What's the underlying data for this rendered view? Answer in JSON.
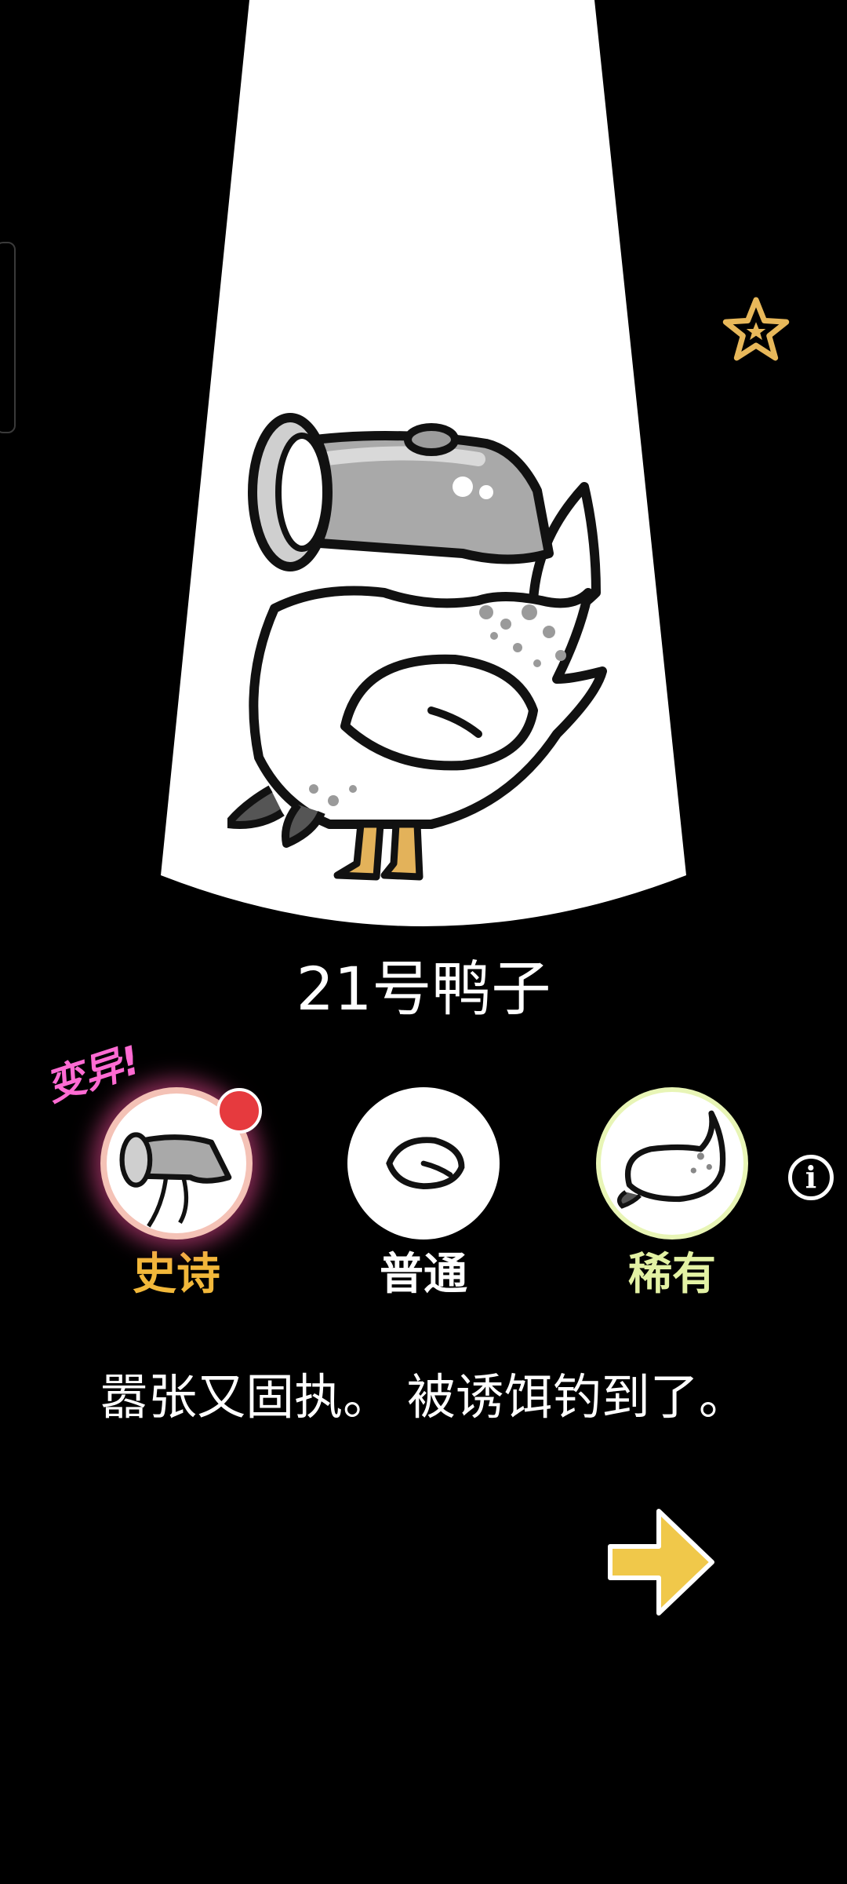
{
  "duck": {
    "name": "21号鸭子",
    "mutation_tag": "变异!",
    "description": "嚣张又固执。 被诱饵钓到了。"
  },
  "variants": [
    {
      "id": "epic",
      "label": "史诗",
      "label_color": "#f2b83a",
      "selected": true,
      "has_notification": true
    },
    {
      "id": "normal",
      "label": "普通",
      "label_color": "#ffffff",
      "selected": false,
      "has_notification": false
    },
    {
      "id": "rare",
      "label": "稀有",
      "label_color": "#e3f2a4",
      "selected": false,
      "has_notification": false
    }
  ],
  "icons": {
    "favorite": "star-outline-icon",
    "info": "info-icon",
    "next": "arrow-right-icon"
  },
  "colors": {
    "background": "#000000",
    "spotlight": "#ffffff",
    "star": "#e8b85a",
    "next_arrow": "#f0c84a",
    "notification": "#e63a3e",
    "mutation_tag": "#ff6bd3"
  }
}
